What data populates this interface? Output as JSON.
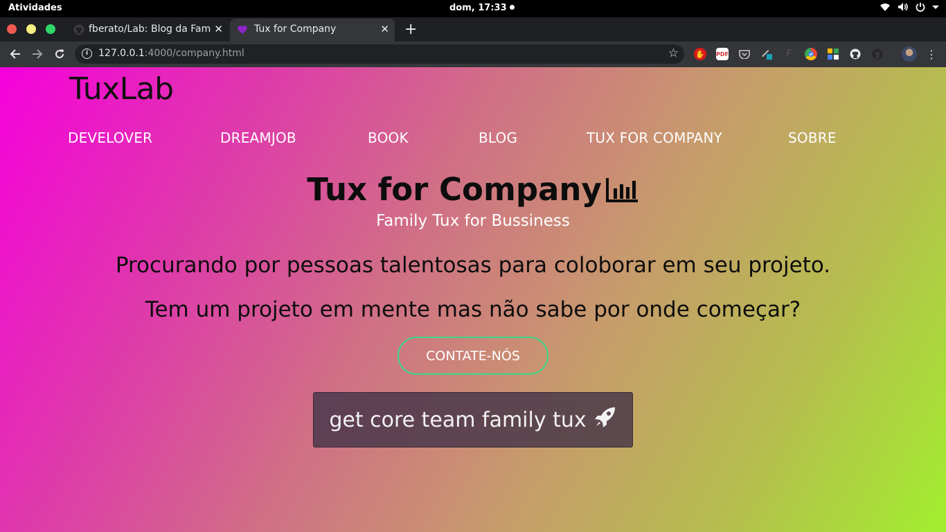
{
  "system_bar": {
    "activities": "Atividades",
    "clock": "dom, 17:33",
    "icons": [
      "wifi-icon",
      "volume-icon",
      "power-icon",
      "chevron-down-icon"
    ]
  },
  "browser": {
    "tabs": [
      {
        "title": "fberato/Lab: Blog da Famí",
        "favicon": "github-icon",
        "active": false
      },
      {
        "title": "Tux for Company",
        "favicon": "purple-heart-icon",
        "active": true
      }
    ],
    "new_tab": "+",
    "url": {
      "host": "127.0.0.1",
      "rest": ":4000/company.html"
    },
    "extensions": [
      "adblock-icon",
      "pdf-icon",
      "pocket-icon",
      "pen-icon",
      "font-icon",
      "chrome-ext-icon",
      "grid-ext-icon",
      "github-icon",
      "github-dark-icon",
      "avatar"
    ]
  },
  "page": {
    "brand": "TuxLab",
    "nav": [
      "DEVELOVER",
      "DREAMJOB",
      "BOOK",
      "BLOG",
      "TUX FOR COMPANY",
      "SOBRE"
    ],
    "title": "Tux for Company",
    "subtitle": "Family Tux for Bussiness",
    "line1": "Procurando por pessoas talentosas para coloborar em seu projeto.",
    "line2": "Tem um projeto em mente mas não sabe por onde começar?",
    "contact_button": "CONTATE-NÓS",
    "core_button": "get core team family tux"
  },
  "colors": {
    "gradient_start": "#f600dc",
    "gradient_end": "#a2ee2f",
    "contact_border": "#39d98a"
  }
}
